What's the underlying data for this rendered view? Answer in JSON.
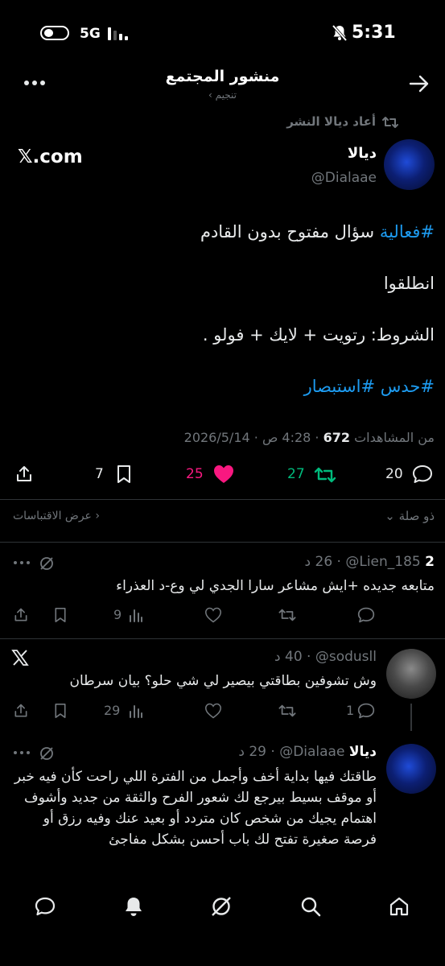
{
  "status_bar": {
    "network": "5G",
    "time": "5:31"
  },
  "header": {
    "title": "منشور المجتمع",
    "subtitle": "تنجيم ›"
  },
  "repost_banner": "أعاد ديالا النشر",
  "x_domain": "𝕏.com",
  "post": {
    "author_name": "ديالا",
    "author_handle": "@Dialaae",
    "hashtag1": "#فعالية",
    "line1_text": " سؤال مفتوح بدون القادم",
    "line2": "انطلقوا",
    "line3": "الشروط: رتويت + لايك + فولو .",
    "hashtags_bottom": "#حدس #استبصار",
    "date": "2026/5/14",
    "time": "4:28 ص",
    "views_count": "672",
    "views_label": "من المشاهدات",
    "replies": "20",
    "reposts": "27",
    "likes": "25",
    "bookmarks": "7"
  },
  "sort": {
    "relevance": "ذو صلة",
    "quotes": "عرض الاقتباسات"
  },
  "replies": [
    {
      "name": "2",
      "handle": "@Lien_185",
      "time": "26 د",
      "text": "متابعه جديده +ايش مشاعر سارا الجدي لي وع-د العذراء",
      "reply_count": "",
      "views": "9"
    },
    {
      "name": "",
      "handle": "@sodusll",
      "time": "40 د",
      "text": "وش تشوفين بطاقتي بيصير لي شي حلو؟ بيان سرطان",
      "reply_count": "1",
      "views": "29"
    },
    {
      "name": "ديالا",
      "handle": "@Dialaae",
      "time": "29 د",
      "text": "طاقتك فيها بداية أخف وأجمل من الفترة اللي راحت كأن فيه خبر أو موقف بسيط بيرجع لك شعور الفرح والثقة من جديد وأشوف اهتمام يجيك من شخص كان متردد أو بعيد عنك وفيه رزق أو فرصة صغيرة تفتح لك باب أحسن بشكل مفاجئ"
    }
  ],
  "bottom_nav": [
    "home-icon",
    "search-icon",
    "grok-icon",
    "notifications-icon",
    "messages-icon"
  ]
}
